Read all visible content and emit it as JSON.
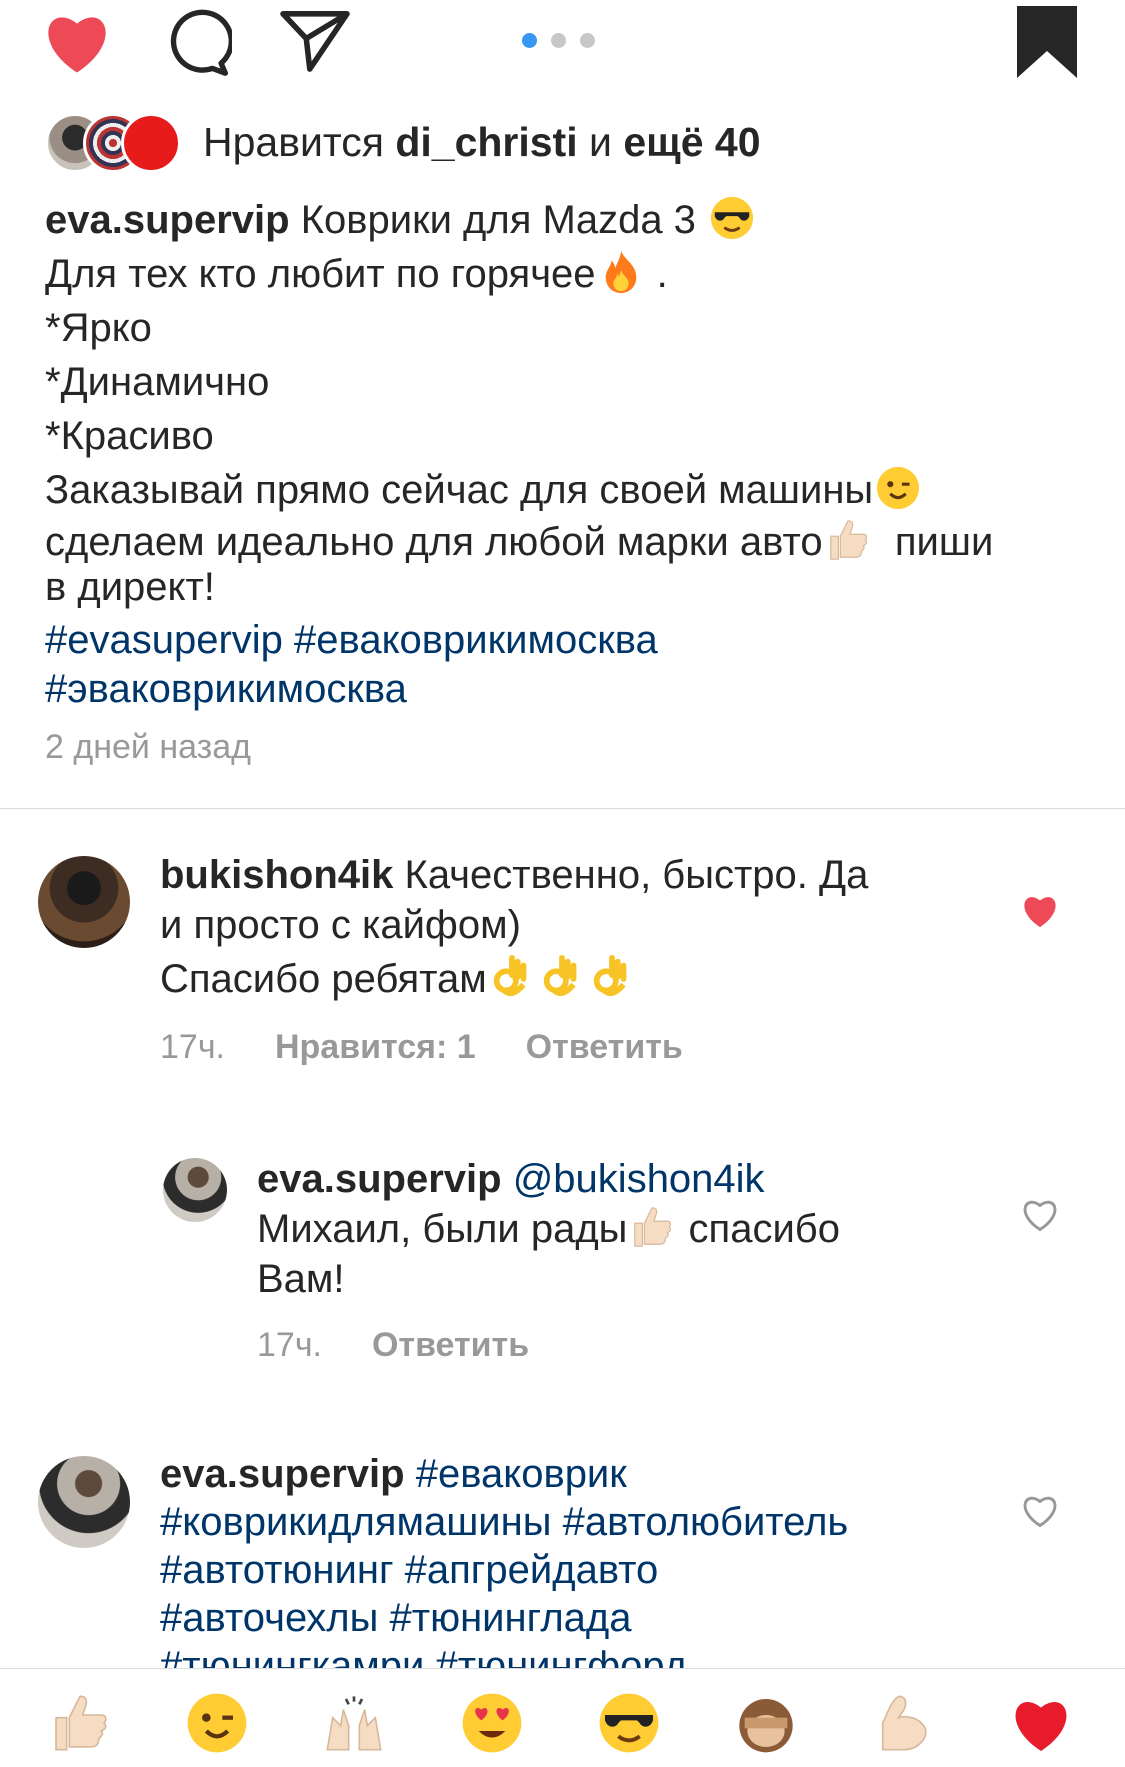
{
  "action_bar": {
    "icons": [
      "heart-filled-icon",
      "comment-icon",
      "share-icon",
      "bookmark-filled-icon"
    ],
    "carousel_dots": 3,
    "active_dot": 0,
    "colors": {
      "like": "#ed4956",
      "dot_active": "#3897f0",
      "dot": "#c7c7c7"
    }
  },
  "likes": {
    "prefix": "Нравится",
    "user": "di_christi",
    "conj": "и",
    "others": "ещё 40"
  },
  "caption": {
    "username": "eva.supervip",
    "line1_text": "Коврики для Mazda 3",
    "line2_text": "Для тех кто любит по горячее",
    "line2_end": ".",
    "line3": "*Ярко",
    "line4": "*Динамично",
    "line5": "*Красиво",
    "line6_text": "Заказывай прямо сейчас для своей машины",
    "line7_text": "сделаем идеально для любой марки авто",
    "line7_end": "пиши",
    "line8": "в директ!",
    "hashtags_line1": "#evasupervip #еваковрикимосква",
    "hashtags_line2": "#эваковрикимосква",
    "emojis": [
      "sunglasses-emoji",
      "fire-emoji",
      "wink-emoji",
      "thumbs-up-emoji"
    ]
  },
  "post_time": "2 дней назад",
  "comments": [
    {
      "username": "bukishon4ik",
      "text_line1": "Качественно, быстро. Да",
      "text_line2": "и просто с кайфом)",
      "text_line3": "Спасибо ребятам",
      "emojis": [
        "ok-hand-emoji",
        "ok-hand-emoji",
        "ok-hand-emoji"
      ],
      "time": "17ч.",
      "likes_label": "Нравится: 1",
      "reply_label": "Ответить",
      "liked": true
    },
    {
      "username": "eva.supervip",
      "mention": "@bukishon4ik",
      "text_line1": "Михаил, были рады",
      "text_line1_end": "спасибо",
      "text_line2": "Вам!",
      "time": "17ч.",
      "reply_label": "Ответить",
      "liked": false
    },
    {
      "username": "eva.supervip",
      "tags_line1": "#еваковрик",
      "tags_line2": "#коврикидлямашины #автолюбитель",
      "tags_line3": "#автотюнинг #апгрейдавто",
      "tags_line4": "#авточехлы #тюнинглада",
      "tags_line5": "#тюнингкамри #тюнингфорд",
      "liked": false
    }
  ],
  "emoji_bar": [
    "thumbs-up-emoji",
    "wink-emoji",
    "raising-hands-emoji",
    "heart-eyes-emoji",
    "sunglasses-emoji",
    "see-no-evil-monkey-emoji",
    "flexed-biceps-emoji",
    "red-heart-emoji"
  ]
}
